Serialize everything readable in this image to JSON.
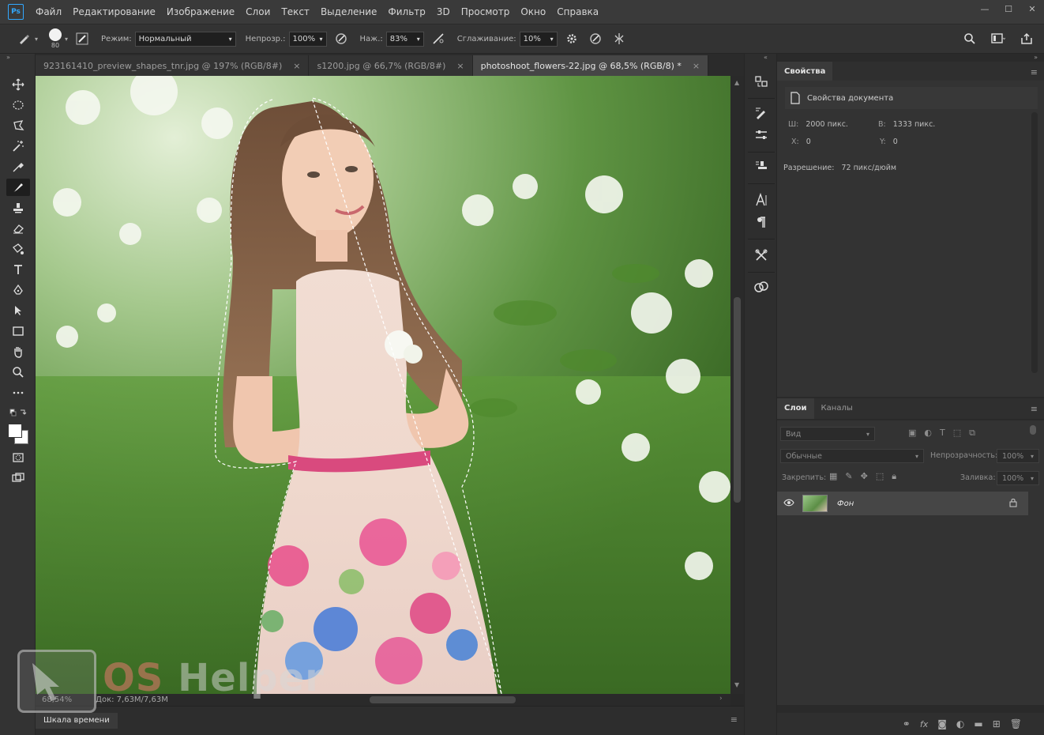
{
  "app": {
    "logo": "Ps"
  },
  "menu": [
    "Файл",
    "Редактирование",
    "Изображение",
    "Слои",
    "Текст",
    "Выделение",
    "Фильтр",
    "3D",
    "Просмотр",
    "Окно",
    "Справка"
  ],
  "window_controls": {
    "minimize": "—",
    "maximize": "☐",
    "close": "✕"
  },
  "options": {
    "brush_size": "80",
    "mode_label": "Режим:",
    "mode_value": "Нормальный",
    "opacity_label": "Непрозр.:",
    "opacity_value": "100%",
    "pressure_label": "Наж.:",
    "pressure_value": "83%",
    "smoothing_label": "Сглаживание:",
    "smoothing_value": "10%"
  },
  "tabs": [
    {
      "label": "923161410_preview_shapes_tnr.jpg @ 197% (RGB/8#)",
      "close": "×"
    },
    {
      "label": "s1200.jpg @ 66,7% (RGB/8#)",
      "close": "×"
    },
    {
      "label": "photoshoot_flowers-22.jpg @ 68,5% (RGB/8) *",
      "close": "×"
    }
  ],
  "status": {
    "zoom": "68,54%",
    "doc": "Док: 7,63M/7,63M"
  },
  "timeline": {
    "label": "Шкала времени"
  },
  "properties": {
    "tab": "Свойства",
    "title": "Свойства документа",
    "w_label": "Ш:",
    "w_value": "2000 пикс.",
    "h_label": "В:",
    "h_value": "1333 пикс.",
    "x_label": "X:",
    "x_value": "0",
    "y_label": "Y:",
    "y_value": "0",
    "res_label": "Разрешение:",
    "res_value": "72 пикс/дюйм"
  },
  "layers": {
    "tab_layers": "Слои",
    "tab_channels": "Каналы",
    "search_placeholder": "Вид",
    "blend_mode": "Обычные",
    "opacity_label": "Непрозрачность:",
    "opacity_value": "100%",
    "lock_label": "Закрепить:",
    "fill_label": "Заливка:",
    "fill_value": "100%",
    "layer_name": "Фон"
  },
  "watermark": {
    "brand_os": "OS",
    "brand_helper": "Helper"
  }
}
